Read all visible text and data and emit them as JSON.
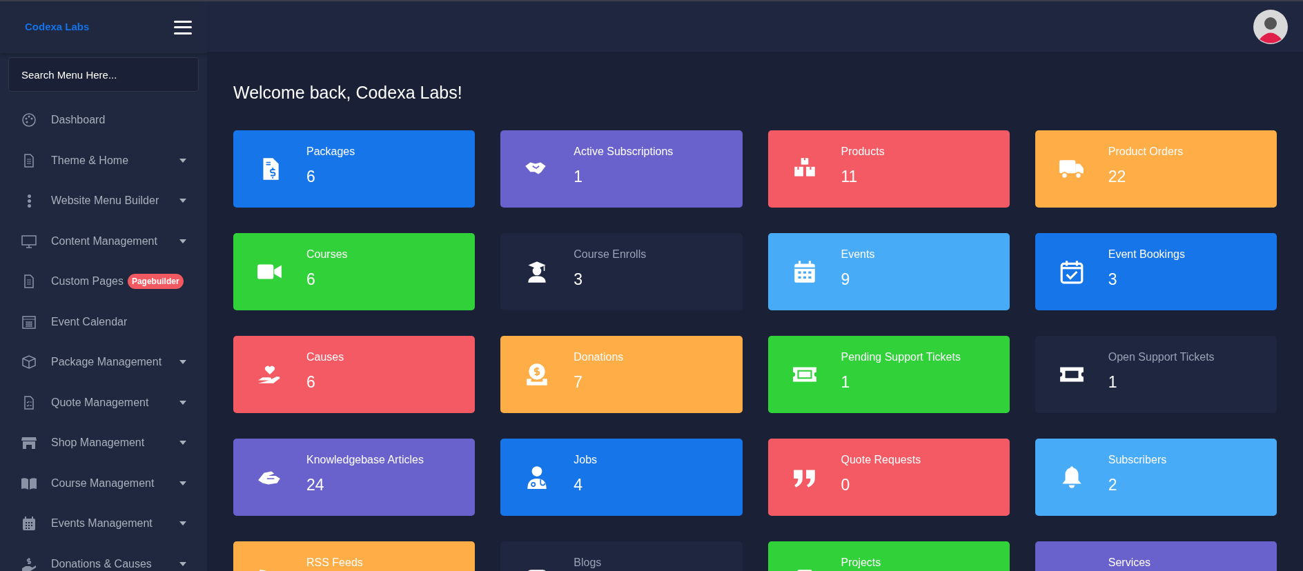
{
  "brand": "Codexa Labs",
  "search": {
    "placeholder": "Search Menu Here..."
  },
  "sidebar": {
    "items": [
      {
        "label": "Dashboard",
        "dropdown": false
      },
      {
        "label": "Theme & Home",
        "dropdown": true
      },
      {
        "label": "Website Menu Builder",
        "dropdown": true
      },
      {
        "label": "Content Management",
        "dropdown": true
      },
      {
        "label": "Custom Pages",
        "dropdown": false,
        "badge": "Pagebuilder"
      },
      {
        "label": "Event Calendar",
        "dropdown": false
      },
      {
        "label": "Package Management",
        "dropdown": true
      },
      {
        "label": "Quote Management",
        "dropdown": true
      },
      {
        "label": "Shop Management",
        "dropdown": true
      },
      {
        "label": "Course Management",
        "dropdown": true
      },
      {
        "label": "Events Management",
        "dropdown": true
      },
      {
        "label": "Donations & Causes",
        "dropdown": true
      }
    ]
  },
  "welcome": "Welcome back, Codexa Labs!",
  "cards": [
    {
      "title": "Packages",
      "count": "6",
      "color": "#1675e8"
    },
    {
      "title": "Active Subscriptions",
      "count": "1",
      "color": "#6a62cc"
    },
    {
      "title": "Products",
      "count": "11",
      "color": "#f35a63"
    },
    {
      "title": "Product Orders",
      "count": "22",
      "color": "#ffad46"
    },
    {
      "title": "Courses",
      "count": "6",
      "color": "#31d13a"
    },
    {
      "title": "Course Enrolls",
      "count": "3",
      "color": "#1f2640"
    },
    {
      "title": "Events",
      "count": "9",
      "color": "#48abf7"
    },
    {
      "title": "Event Bookings",
      "count": "3",
      "color": "#1675e8"
    },
    {
      "title": "Causes",
      "count": "6",
      "color": "#f35a63"
    },
    {
      "title": "Donations",
      "count": "7",
      "color": "#ffad46"
    },
    {
      "title": "Pending Support Tickets",
      "count": "1",
      "color": "#31d13a"
    },
    {
      "title": "Open Support Tickets",
      "count": "1",
      "color": "#1f2640"
    },
    {
      "title": "Knowledgebase Articles",
      "count": "24",
      "color": "#6a62cc"
    },
    {
      "title": "Jobs",
      "count": "4",
      "color": "#1675e8"
    },
    {
      "title": "Quote Requests",
      "count": "0",
      "color": "#f35a63"
    },
    {
      "title": "Subscribers",
      "count": "2",
      "color": "#48abf7"
    },
    {
      "title": "RSS Feeds",
      "color": "#ffad46"
    },
    {
      "title": "Blogs",
      "color": "#1f2640"
    },
    {
      "title": "Projects",
      "color": "#31d13a"
    },
    {
      "title": "Services",
      "color": "#6a62cc"
    }
  ]
}
